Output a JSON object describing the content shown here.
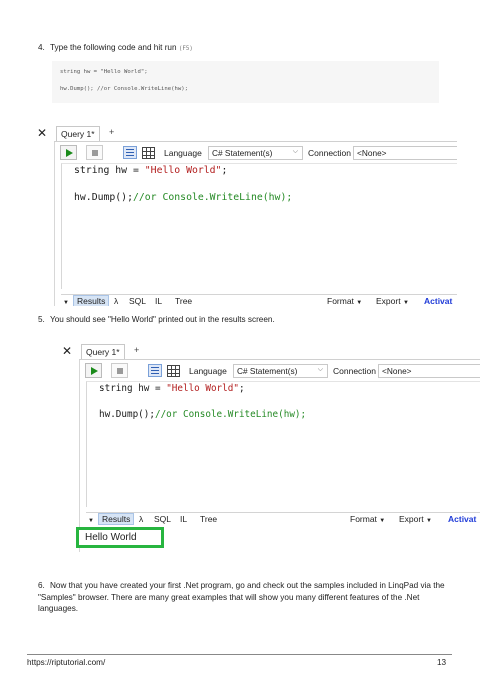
{
  "step4": {
    "number": "4.",
    "text": "Type the following code and hit run",
    "key_open": "(",
    "key": "F5",
    "key_close": ")"
  },
  "code_block": {
    "lines": [
      "string hw = \"Hello World\";",
      "hw.Dump(); //or Console.WriteLine(hw);"
    ]
  },
  "screenshot1": {
    "close_glyph": "✕",
    "tab_label": "Query 1*",
    "tab_add": "+",
    "language_label": "Language",
    "language_value": "C# Statement(s)",
    "dropdown_arrow": "⌵",
    "connection_label": "Connection",
    "connection_value": "<None>",
    "code": {
      "kw1": "string",
      "plain1": " hw = ",
      "str1": "\"Hello World\"",
      "semi1": ";",
      "plain2": "hw.Dump();",
      "cmt2": "//or Console.WriteLine(hw);"
    },
    "results_tabs": [
      "Results",
      "λ",
      "SQL",
      "IL",
      "Tree"
    ],
    "format_label": "Format",
    "export_label": "Export",
    "activate_label": "Activat",
    "tri": "▼"
  },
  "step5": {
    "number": "5.",
    "text": "You should see \"Hello World\" printed out in the results screen."
  },
  "screenshot2": {
    "close_glyph": "✕",
    "tab_label": "Query 1*",
    "tab_add": "+",
    "language_label": "Language",
    "language_value": "C# Statement(s)",
    "dropdown_arrow": "⌵",
    "connection_label": "Connection",
    "connection_value": "<None>",
    "code": {
      "kw1": "string",
      "plain1": " hw = ",
      "str1": "\"Hello World\"",
      "semi1": ";",
      "plain2": "hw.Dump();",
      "cmt2": "//or Console.WriteLine(hw);"
    },
    "results_tabs": [
      "Results",
      "λ",
      "SQL",
      "IL",
      "Tree"
    ],
    "format_label": "Format",
    "export_label": "Export",
    "activate_label": "Activat",
    "tri": "▼",
    "output": "Hello World"
  },
  "step6": {
    "number": "6.",
    "text": "Now that you have created your first .Net program, go and check out the samples included in LinqPad via the \"Samples\" browser. There are many great examples that will show you many different features of the .Net languages."
  },
  "footer": {
    "url": "https://riptutorial.com/",
    "page": "13"
  },
  "colors": {
    "highlight_border": "#27b53f",
    "string": "#b21d1d",
    "comment": "#258a25",
    "activate": "#1f3bd8"
  }
}
